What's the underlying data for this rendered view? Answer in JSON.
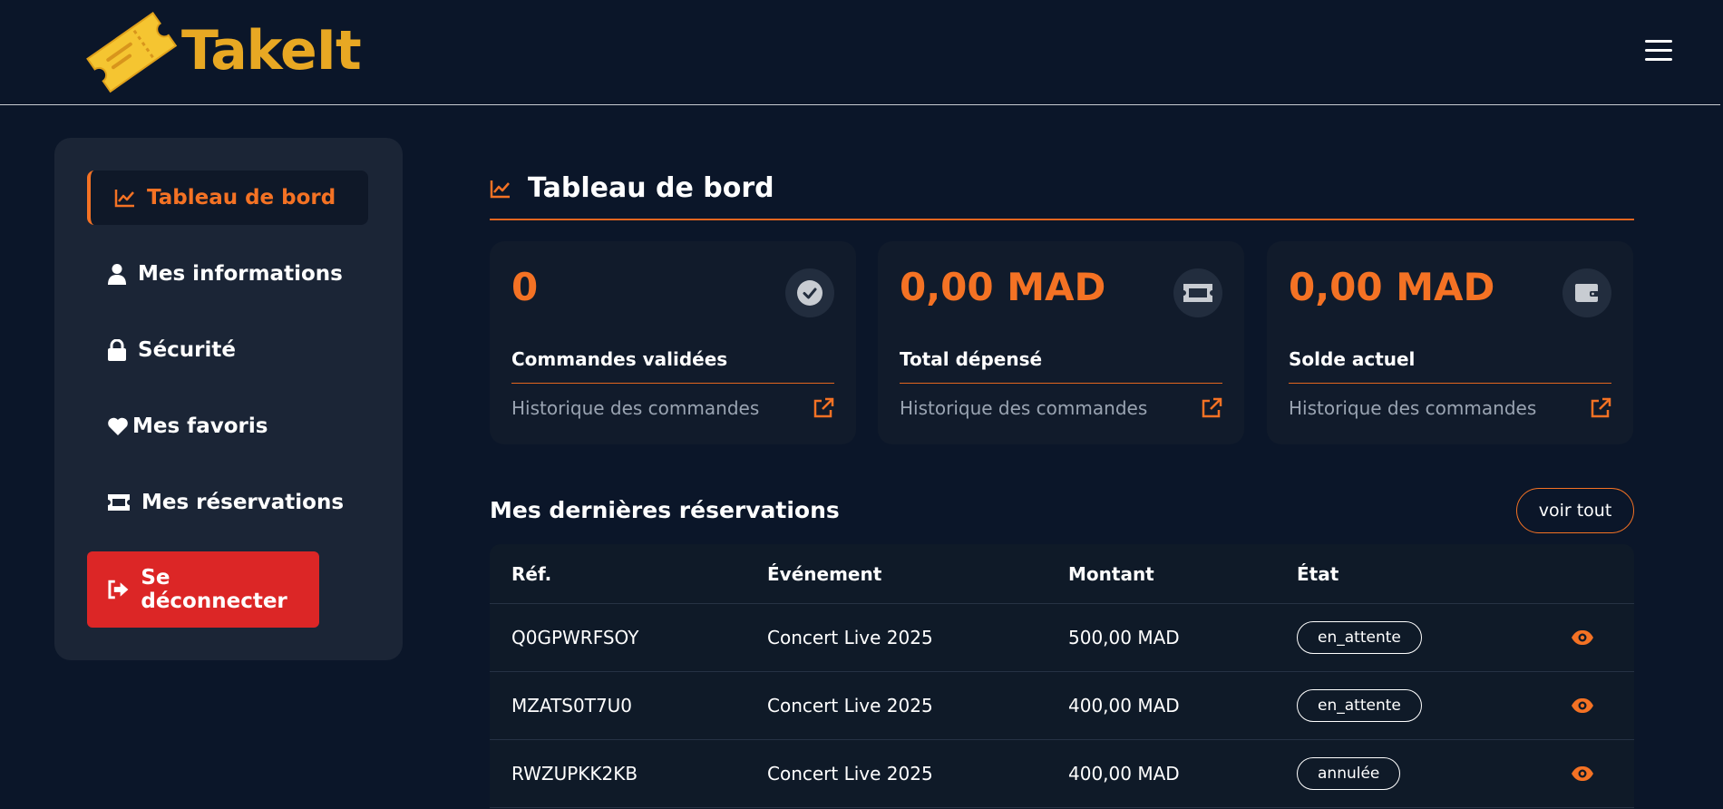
{
  "header": {
    "brand": "TakeIt",
    "menu_icon": "hamburger-icon"
  },
  "colors": {
    "accent": "#f47224",
    "brand": "#e8a823",
    "danger": "#dc2626",
    "background": "#0b1629"
  },
  "sidebar": {
    "items": [
      {
        "label": "Tableau de bord",
        "icon": "chart-line-icon",
        "active": true
      },
      {
        "label": "Mes informations",
        "icon": "user-icon",
        "active": false
      },
      {
        "label": "Sécurité",
        "icon": "lock-icon",
        "active": false
      },
      {
        "label": "Mes favoris",
        "icon": "heart-icon",
        "active": false
      },
      {
        "label": "Mes réservations",
        "icon": "ticket-icon",
        "active": false
      }
    ],
    "logout_label": "Se déconnecter"
  },
  "dashboard": {
    "title": "Tableau de bord",
    "cards": [
      {
        "value": "0",
        "label": "Commandes validées",
        "link": "Historique des commandes",
        "icon": "check-circle-icon"
      },
      {
        "value": "0,00 MAD",
        "label": "Total dépensé",
        "link": "Historique des commandes",
        "icon": "ticket-icon"
      },
      {
        "value": "0,00 MAD",
        "label": "Solde actuel",
        "link": "Historique des commandes",
        "icon": "wallet-icon"
      }
    ]
  },
  "reservations": {
    "title": "Mes dernières réservations",
    "see_all": "voir tout",
    "columns": [
      "Réf.",
      "Événement",
      "Montant",
      "État"
    ],
    "rows": [
      {
        "ref": "Q0GPWRFSOY",
        "event": "Concert Live 2025",
        "amount": "500,00 MAD",
        "status": "en_attente"
      },
      {
        "ref": "MZATS0T7U0",
        "event": "Concert Live 2025",
        "amount": "400,00 MAD",
        "status": "en_attente"
      },
      {
        "ref": "RWZUPKK2KB",
        "event": "Concert Live 2025",
        "amount": "400,00 MAD",
        "status": "annulée"
      }
    ]
  }
}
